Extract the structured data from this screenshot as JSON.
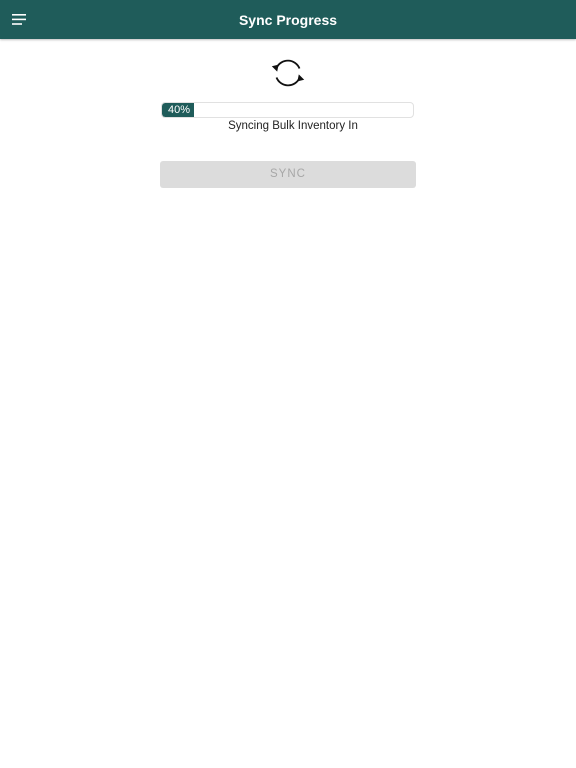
{
  "header": {
    "title": "Sync Progress",
    "menu_icon": "hamburger-menu-icon",
    "background_color": "#1f5c5a"
  },
  "sync": {
    "icon": "sync-icon",
    "progress_percent": 40,
    "progress_label": "40%",
    "status_text": "Syncing Bulk Inventory In",
    "progress_color": "#1f5c5a"
  },
  "actions": {
    "sync_button_label": "SYNC",
    "sync_button_disabled": true
  }
}
